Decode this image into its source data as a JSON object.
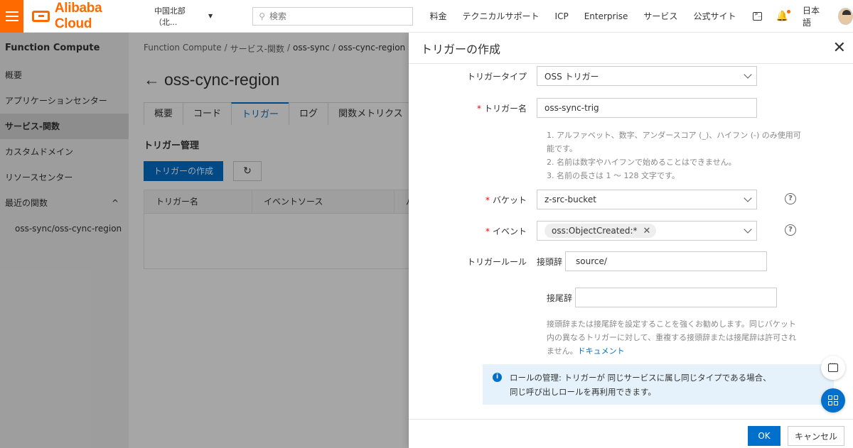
{
  "topbar": {
    "brand": "Alibaba Cloud",
    "region": "中国北部（北...",
    "search_placeholder": "検索",
    "nav": [
      "料金",
      "テクニカルサポート",
      "ICP",
      "Enterprise",
      "サービス",
      "公式サイト"
    ],
    "language": "日本語",
    "accent_color": "#ff6a00"
  },
  "sidebar": {
    "title": "Function Compute",
    "items": [
      {
        "label": "概要"
      },
      {
        "label": "アプリケーションセンター"
      },
      {
        "label": "サービス-関数",
        "active": true
      },
      {
        "label": "カスタムドメイン"
      },
      {
        "label": "リソースセンター"
      },
      {
        "label": "最近の関数"
      },
      {
        "label": "oss-sync/oss-cync-region"
      }
    ]
  },
  "main": {
    "breadcrumb": [
      "Function Compute",
      "/",
      "サービス-関数",
      "/",
      "oss-sync",
      "/",
      "oss-cync-region"
    ],
    "title": "oss-cync-region",
    "tabs": [
      "概要",
      "コード",
      "トリガー",
      "ログ",
      "関数メトリクス"
    ],
    "active_tab": "トリガー",
    "section_title": "トリガー管理",
    "create_button": "トリガーの作成",
    "table_headers": [
      "トリガー名",
      "イベントソース",
      "パ"
    ]
  },
  "drawer": {
    "title": "トリガーの作成",
    "trigger_type_label": "トリガータイプ",
    "trigger_type_value": "OSS トリガー",
    "trigger_name_label": "トリガー名",
    "trigger_name_value": "oss-sync-trig",
    "name_hints": [
      "1. アルファベット、数字、アンダースコア (_)、ハイフン (-) のみ使用可",
      "能です。",
      "2. 名前は数字やハイフンで始めることはできません。",
      "3. 名前の長さは 1 ～ 128 文字です。"
    ],
    "bucket_label": "バケット",
    "bucket_value": "z-src-bucket",
    "event_label": "イベント",
    "event_tag": "oss:ObjectCreated:*",
    "rule_label": "トリガールール",
    "prefix_label": "接頭辞",
    "prefix_value": "source/",
    "suffix_label": "接尾辞",
    "suffix_value": "",
    "rule_hint_1": "接頭辞または接尾辞を設定することを強くお勧めします。同じバケット",
    "rule_hint_2": "内の異なるトリガーに対して、重複する接頭辞または接尾辞は許可され",
    "rule_hint_3": "ません。",
    "rule_hint_link": "ドキュメント",
    "info_line_1": "ロールの管理: トリガーが 同じサービスに属し同じタイプである場合、",
    "info_line_2": "同じ呼び出しロールを再利用できます。",
    "ok": "OK",
    "cancel": "キャンセル",
    "primary_color": "#0070cc"
  }
}
